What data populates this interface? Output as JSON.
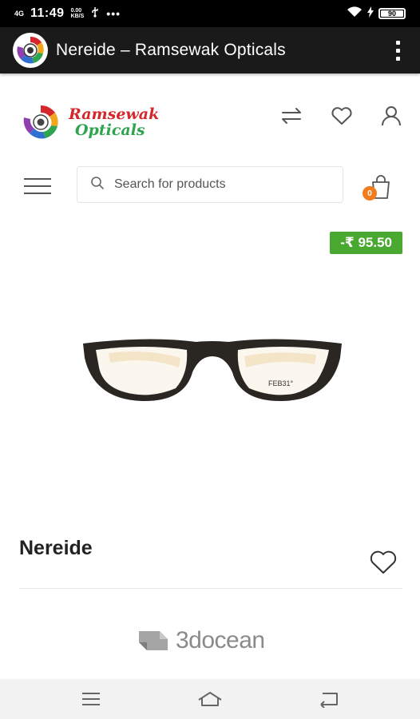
{
  "status_bar": {
    "network": "4G",
    "time": "11:49",
    "speed_value": "0.00",
    "speed_unit": "KB/S",
    "more": "•••",
    "battery": "90"
  },
  "app_bar": {
    "title": "Nereide – Ramsewak Opticals"
  },
  "header": {
    "logo_line1": "Ramsewak",
    "logo_line2": "Opticals",
    "search_placeholder": "Search for products",
    "cart_count": "0"
  },
  "product": {
    "price": "-₹ 95.50",
    "name": "Nereide",
    "frame_text": "FEB31°"
  },
  "footer": {
    "brand": "3docean"
  },
  "colors": {
    "app_bar": "#1a1a1a",
    "price_badge": "#49a82f",
    "cart_badge": "#f07c1d",
    "logo_red": "#d4262b",
    "logo_green": "#2ea44f"
  },
  "icons": {
    "compare": "compare-arrows-icon",
    "wishlist": "heart-icon",
    "account": "user-icon",
    "search": "search-icon",
    "cart": "shopping-bag-icon"
  }
}
